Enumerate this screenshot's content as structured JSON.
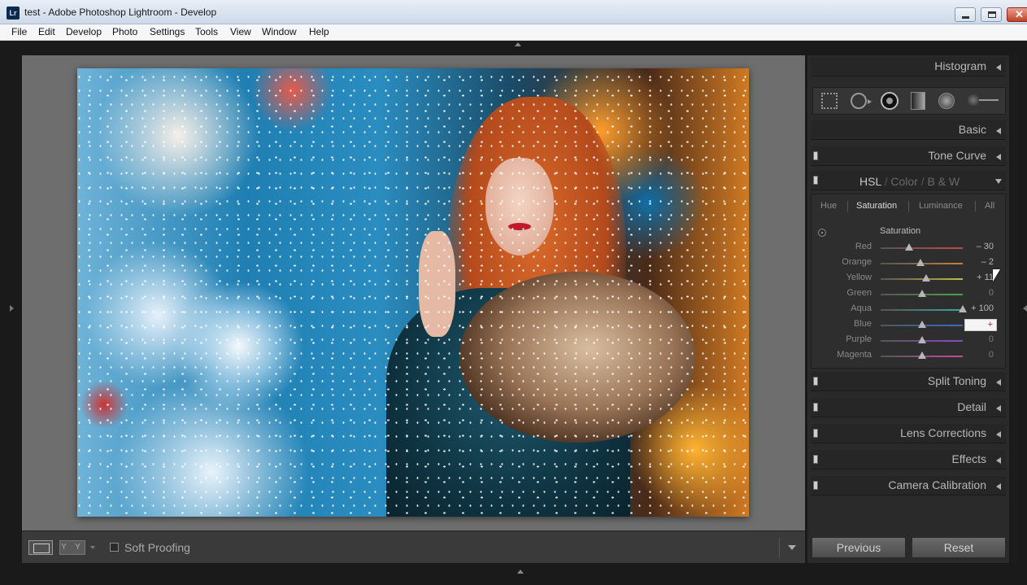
{
  "window": {
    "title": "test - Adobe Photoshop Lightroom - Develop",
    "app_icon": "Lr"
  },
  "menu": [
    "File",
    "Edit",
    "Develop",
    "Photo",
    "Settings",
    "Tools",
    "View",
    "Window",
    "Help"
  ],
  "toolbar": {
    "yy": "Y Y",
    "soft_proofing": "Soft Proofing"
  },
  "panel": {
    "histogram": "Histogram",
    "basic": "Basic",
    "tone_curve": "Tone Curve",
    "hsl": {
      "hsl": "HSL",
      "sep1": "/",
      "color": "Color",
      "sep2": "/",
      "bw": "B & W"
    },
    "tabs": [
      "Hue",
      "Saturation",
      "Luminance",
      "All"
    ],
    "sub_header": "Saturation",
    "sliders": [
      {
        "name": "Red",
        "value": "– 30",
        "level": -30
      },
      {
        "name": "Orange",
        "value": "– 2",
        "level": -2
      },
      {
        "name": "Yellow",
        "value": "+ 11",
        "level": 11
      },
      {
        "name": "Green",
        "value": "0",
        "level": 0
      },
      {
        "name": "Aqua",
        "value": "+ 100",
        "level": 100
      },
      {
        "name": "Blue",
        "value": "+",
        "level": 0
      },
      {
        "name": "Purple",
        "value": "0",
        "level": 0
      },
      {
        "name": "Magenta",
        "value": "0",
        "level": 0
      }
    ],
    "split_toning": "Split Toning",
    "detail": "Detail",
    "lens_corrections": "Lens Corrections",
    "effects": "Effects",
    "camera_calibration": "Camera Calibration",
    "previous": "Previous",
    "reset": "Reset"
  },
  "colors": {
    "accent_red": "#c0192a",
    "panel_bg": "#2a2a2a",
    "canvas_bg": "#6e6e6e"
  }
}
